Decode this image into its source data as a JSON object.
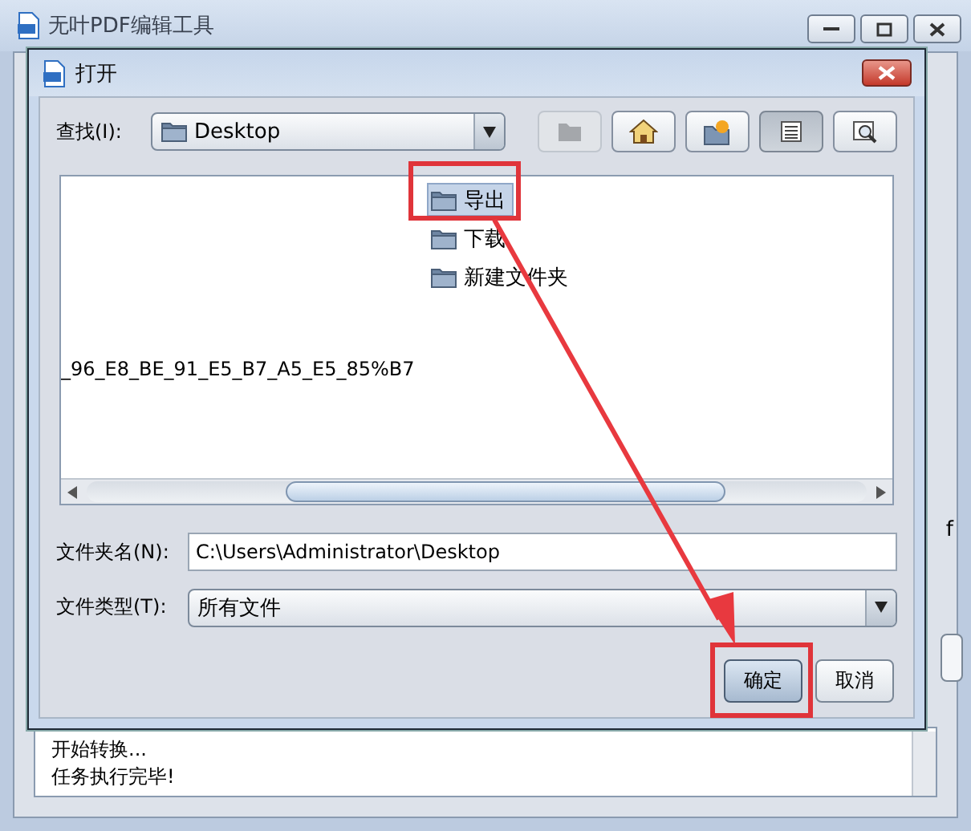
{
  "app_window": {
    "title": "无叶PDF编辑工具",
    "side_text": "f",
    "log": [
      "开始转换...",
      "任务执行完毕!"
    ]
  },
  "dialog": {
    "title": "打开",
    "look_in": {
      "label": "查找(I):",
      "value": "Desktop"
    },
    "toolbar": [
      {
        "kind": "up",
        "disabled": true,
        "selected": false
      },
      {
        "kind": "home",
        "disabled": false,
        "selected": false
      },
      {
        "kind": "new_folder",
        "disabled": false,
        "selected": false
      },
      {
        "kind": "list",
        "disabled": false,
        "selected": true
      },
      {
        "kind": "details",
        "disabled": false,
        "selected": false
      }
    ],
    "cut_off_entry": {
      "name": "_96_E8_BE_91_E5_B7_A5_E5_85%B7"
    },
    "files": [
      {
        "name": "导出",
        "kind": "folder",
        "selected": true
      },
      {
        "name": "下载",
        "kind": "folder",
        "selected": false
      },
      {
        "name": "新建文件夹",
        "kind": "folder",
        "selected": false
      }
    ],
    "folder_name": {
      "label": "文件夹名(N):",
      "value": "C:\\Users\\Administrator\\Desktop"
    },
    "file_type": {
      "label": "文件类型(T):",
      "value": "所有文件"
    },
    "buttons": [
      {
        "label": "确定",
        "default": true
      },
      {
        "label": "取消",
        "default": false
      }
    ]
  }
}
